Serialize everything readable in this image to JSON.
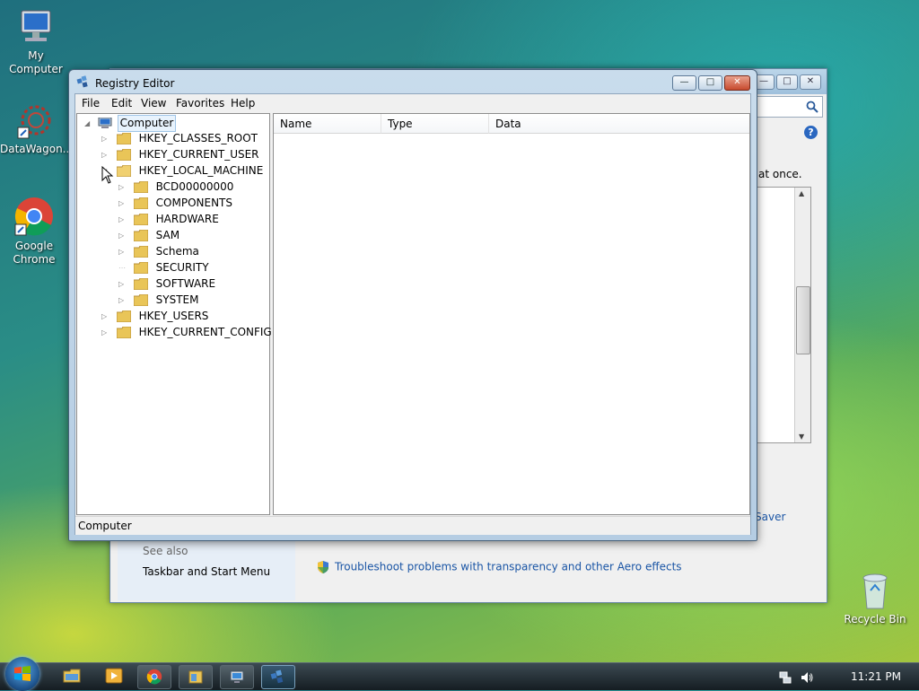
{
  "desktop": {
    "icons": [
      {
        "label": "My Computer"
      },
      {
        "label": "DataWagon..."
      },
      {
        "label": "Google Chrome"
      },
      {
        "label": "Recycle Bin"
      }
    ]
  },
  "background_window": {
    "partial_text": "at once.",
    "saver_text": "Saver",
    "see_also_heading": "See also",
    "taskbar_link": "Taskbar and Start Menu",
    "troubleshoot_link": "Troubleshoot problems with transparency and other Aero effects"
  },
  "regedit": {
    "title": "Registry Editor",
    "menu": [
      "File",
      "Edit",
      "View",
      "Favorites",
      "Help"
    ],
    "tree": {
      "root": "Computer",
      "hives": [
        "HKEY_CLASSES_ROOT",
        "HKEY_CURRENT_USER",
        "HKEY_LOCAL_MACHINE"
      ],
      "hklm_children": [
        "BCD00000000",
        "COMPONENTS",
        "HARDWARE",
        "SAM",
        "Schema",
        "SECURITY",
        "SOFTWARE",
        "SYSTEM"
      ],
      "hives_after": [
        "HKEY_USERS",
        "HKEY_CURRENT_CONFIG"
      ]
    },
    "columns": [
      "Name",
      "Type",
      "Data"
    ],
    "status": "Computer"
  },
  "taskbar": {
    "clock": "11:21 PM"
  },
  "colors": {
    "link": "#1a55a5",
    "folder": "#e9c558",
    "selection": "#e8f3fd"
  }
}
